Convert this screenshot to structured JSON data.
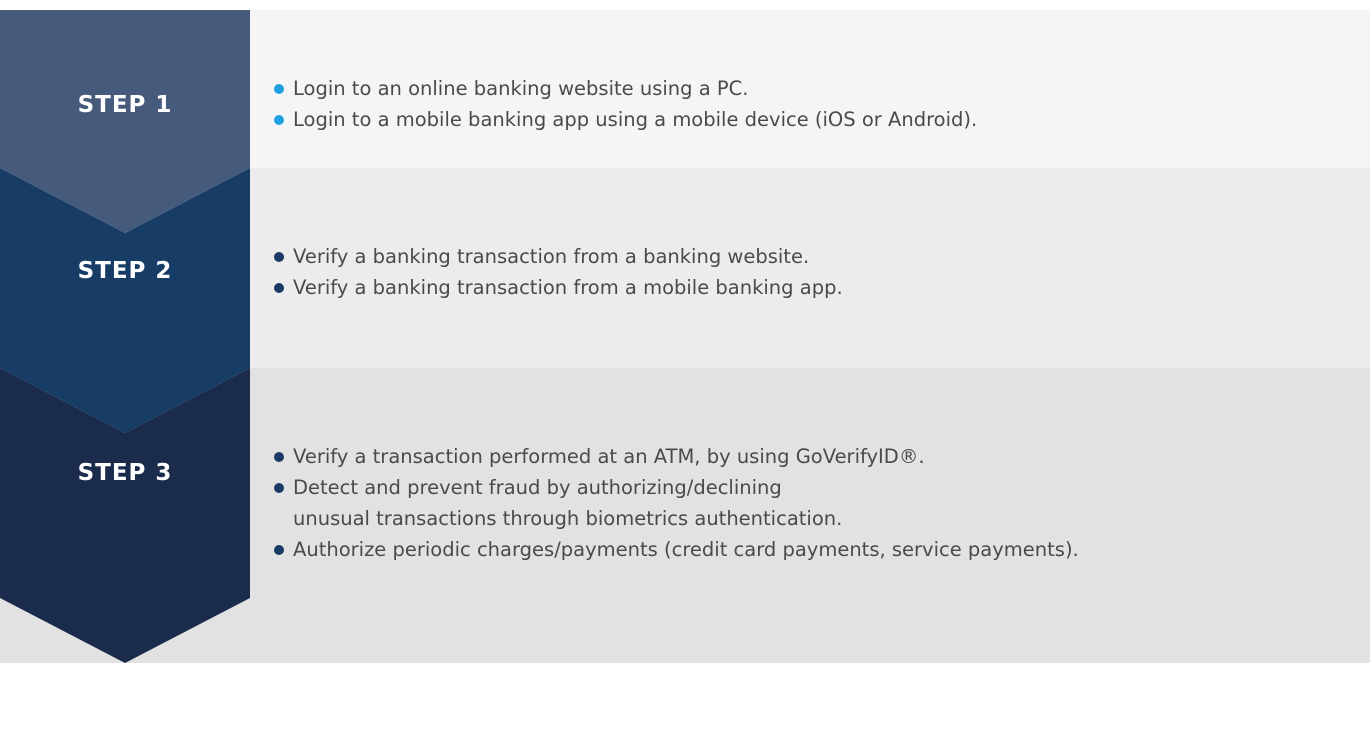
{
  "colors": {
    "step1": "#465a7c",
    "step2": "#173c66",
    "step3": "#1a2b4b",
    "bullet_step1": "#1ea0e0",
    "bullet_other": "#1a3a66",
    "text": "#4a4a4a"
  },
  "steps": [
    {
      "label": "STEP 1",
      "bullets": [
        "Login to an online banking website using a PC.",
        "Login to a mobile banking app using a mobile device (iOS or Android)."
      ]
    },
    {
      "label": "STEP 2",
      "bullets": [
        "Verify a banking transaction from a banking website.",
        "Verify a banking transaction from a mobile banking app."
      ]
    },
    {
      "label": "STEP 3",
      "bullets": [
        "Verify a transaction performed at an ATM, by using GoVerifyID®.",
        "Detect and prevent fraud by authorizing/declining unusual transactions through biometrics authentication.",
        "Authorize periodic charges/payments (credit card payments, service payments)."
      ]
    }
  ]
}
